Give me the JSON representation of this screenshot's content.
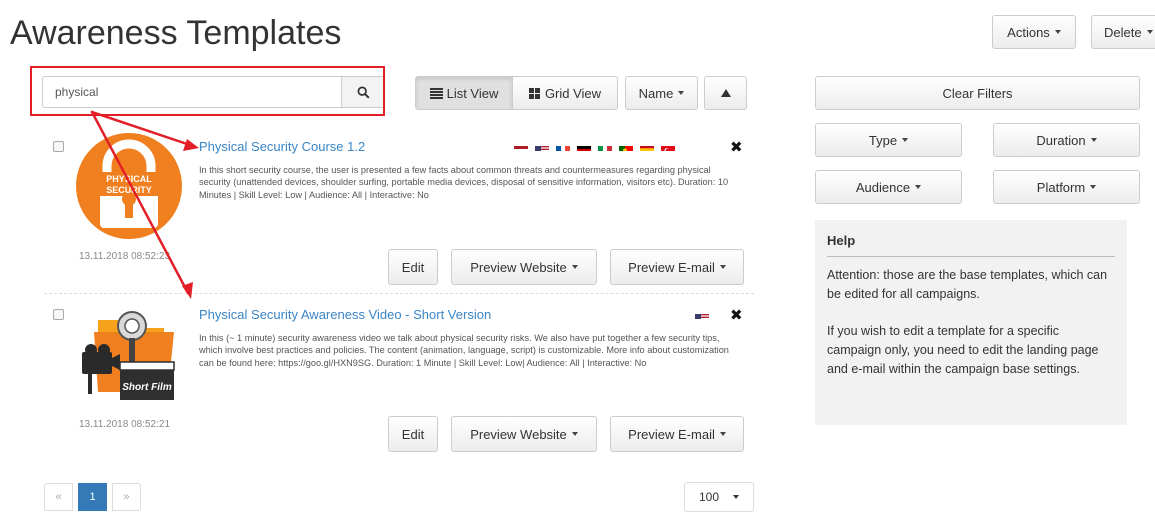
{
  "page": {
    "title": "Awareness Templates"
  },
  "header": {
    "actions_label": "Actions",
    "delete_label": "Delete"
  },
  "search": {
    "value": "physical",
    "placeholder": ""
  },
  "toolbar": {
    "list_view_label": "List View",
    "grid_view_label": "Grid View",
    "sort_label": "Name",
    "sort_direction_icon": "caret-up-icon"
  },
  "templates": [
    {
      "title": "Physical Security Course 1.2",
      "description": "In this short security course, the user is presented a few facts about common threats and countermeasures regarding physical security (unattended devices, shoulder surfing, portable media devices, disposal of sensitive information, visitors etc). Duration: 10 Minutes | Skill Level: Low | Audience: All | Interactive: No",
      "timestamp": "13.11.2018 08:52:23",
      "thumbnail_text": [
        "PHYSICAL",
        "SECURITY"
      ],
      "flags": [
        "netherlands-flag",
        "usa-flag",
        "france-flag",
        "germany-flag",
        "italy-flag",
        "portugal-flag",
        "spain-flag",
        "turkey-flag"
      ],
      "edit_label": "Edit",
      "preview_website_label": "Preview Website",
      "preview_email_label": "Preview E-mail"
    },
    {
      "title": "Physical Security Awareness Video - Short Version",
      "description": "In this (~ 1 minute) security awareness video we talk about physical security risks. We also have put together a few security tips, which involve best practices and policies. The content (animation, language, script) is customizable. More info about customization can be found here: https://goo.gl/HXN9SG. Duration: 1 Minute | Skill Level: Low| Audience: All | Interactive: No",
      "timestamp": "13.11.2018 08:52:21",
      "thumbnail_text": [
        "Short Film"
      ],
      "flags": [
        "usa-flag"
      ],
      "edit_label": "Edit",
      "preview_website_label": "Preview Website",
      "preview_email_label": "Preview E-mail"
    }
  ],
  "filters": {
    "clear_label": "Clear Filters",
    "type_label": "Type",
    "duration_label": "Duration",
    "audience_label": "Audience",
    "platform_label": "Platform"
  },
  "help": {
    "title": "Help",
    "paragraph1": "Attention: those are the base templates, which can be edited for all campaigns.",
    "paragraph2": "If you wish to edit a template for a specific campaign only, you need to edit the landing page and e-mail within the campaign base settings."
  },
  "pagination": {
    "prev": "«",
    "current": "1",
    "next": "»",
    "per_page": "100"
  },
  "colors": {
    "accent": "#3a85c6",
    "annotation_red": "#e21e26",
    "thumbnail_orange": "#f0801f"
  }
}
